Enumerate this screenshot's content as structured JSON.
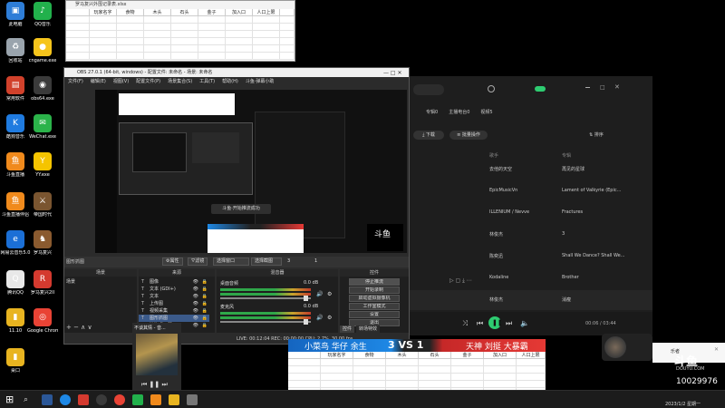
{
  "desktop_icons": [
    {
      "label": "此电脑",
      "color": "#2e7dd7",
      "glyph": "▣"
    },
    {
      "label": "QQ音乐",
      "color": "#22b14c",
      "glyph": "♪"
    },
    {
      "label": "回收站",
      "color": "#9aa4ad",
      "glyph": "♻"
    },
    {
      "label": "cngame.exe",
      "color": "#f6c51c",
      "glyph": "●"
    },
    {
      "label": "常用软件",
      "color": "#d1412b",
      "glyph": "▤"
    },
    {
      "label": "obs64.exe",
      "color": "#3a3a3a",
      "glyph": "◉"
    },
    {
      "label": "酷狗音乐",
      "color": "#1f7be0",
      "glyph": "K"
    },
    {
      "label": "WeChat.exe",
      "color": "#2bb34a",
      "glyph": "✉"
    },
    {
      "label": "斗鱼直播",
      "color": "#f08a1c",
      "glyph": "鱼"
    },
    {
      "label": "YY.exe",
      "color": "#f5c400",
      "glyph": "Y"
    },
    {
      "label": "斗鱼直播伴侣",
      "color": "#f08a1c",
      "glyph": "鱼"
    },
    {
      "label": "帝国时代",
      "color": "#7a5530",
      "glyph": "⚔"
    },
    {
      "label": "网易云音乐5.0",
      "color": "#1b6fd6",
      "glyph": "e"
    },
    {
      "label": "罗马复兴",
      "color": "#8a5a2f",
      "glyph": "♞"
    },
    {
      "label": "腾讯QQ",
      "color": "#e8e8e8",
      "glyph": "Q"
    },
    {
      "label": "罗马复兴2II",
      "color": "#d43a2f",
      "glyph": "R"
    },
    {
      "label": "11.10",
      "color": "#e8b420",
      "glyph": "▮"
    },
    {
      "label": "Google Chrome",
      "color": "#e94335",
      "glyph": "◎"
    },
    {
      "label": "桌口",
      "color": "#e8b420",
      "glyph": "▮"
    }
  ],
  "sheet_top": {
    "title": "罗马复兴外围记录表.xlsx",
    "headers": [
      "玩家名字",
      "食物",
      "木头",
      "石头",
      "金子",
      "加入口",
      "人口上限"
    ]
  },
  "obs": {
    "title": "OBS 27.0.1 (64-bit, windows) - 配置文件: 未命名 - 场景: 未命名",
    "menu": [
      "文件(F)",
      "编辑(E)",
      "视图(V)",
      "配置文件(P)",
      "场景集合(S)",
      "工具(T)",
      "帮助(H)",
      "斗鱼·弹幕小助"
    ],
    "toolbar": {
      "label": "图形抓图",
      "properties": "属性",
      "filters": "滤镜",
      "select_window": "选择窗口",
      "select_display": "选择截图",
      "num_a": "3",
      "num_b": "1"
    },
    "panels": {
      "scenes": "场景",
      "sources": "来源",
      "mixer": "混音器",
      "controls": "控件"
    },
    "scene_item": "场景",
    "sources": [
      "图像",
      "文本 (GDI+)",
      "文本",
      "上传图",
      "视频采集",
      "图形抓图",
      "渲染桌面器"
    ],
    "mixer": [
      {
        "name": "桌面音频",
        "db": "0.0 dB"
      },
      {
        "name": "麦克风",
        "db": "0.0 dB"
      }
    ],
    "controls": [
      "停止推流",
      "开始录制",
      "启动虚拟摄像机",
      "工作室模式",
      "设置",
      "退出"
    ],
    "bottom_tabs": [
      "控件",
      "转场特效"
    ],
    "status": "LIVE: 00:12:04  REC: 00:00:00  CPU: 2.7%, 30.00 fps"
  },
  "player": {
    "tabs": [
      "专辑0",
      "主播电台0",
      "视频5"
    ],
    "buttons": {
      "download": "下载",
      "batch": "批量操作",
      "sort": "排序"
    },
    "headers": [
      "歌手",
      "专辑"
    ],
    "rows": [
      {
        "artist": "去他的天空",
        "album": "再见的星球"
      },
      {
        "artist": "EpicMusicVn",
        "album": "Lament of Valkyrie (Epic..."
      },
      {
        "artist": "ILLENIUM / Nevve",
        "album": "Fractures"
      },
      {
        "artist": "林俊杰",
        "album": "3"
      },
      {
        "artist": "陈奕迅",
        "album": "Shall We Dance? Shall We..."
      },
      {
        "artist": "Kodaline",
        "album": "Brother"
      },
      {
        "artist": "林俊杰",
        "album": "消瘦"
      },
      {
        "artist": "韵畅",
        "album": "不谈其情"
      }
    ],
    "time": "00:06 / 03:44",
    "user": "乐者"
  },
  "mini_player": {
    "title": "不谈其情 - 音..."
  },
  "preview_popup": "斗鱼·开始推流成功",
  "vs_banner": {
    "left": "小菜鸟  华仔 余生",
    "center": "3 VS 1",
    "right": "天神 刘挺 大暴霸"
  },
  "vs_sheet": {
    "headers": [
      "玩家名字",
      "食物",
      "木头",
      "石头",
      "金子",
      "加入口",
      "人口上限"
    ]
  },
  "douyu": {
    "logo": "斗鱼",
    "domain": "DOUYU.COM",
    "room": "10029976",
    "date": "2023/1/2 星期一"
  },
  "colors": {
    "accent_green": "#2ecc71",
    "douyu_orange": "#f08a1c",
    "obs_bg": "#2b2b2b",
    "player_bg": "#1e1e1e"
  }
}
